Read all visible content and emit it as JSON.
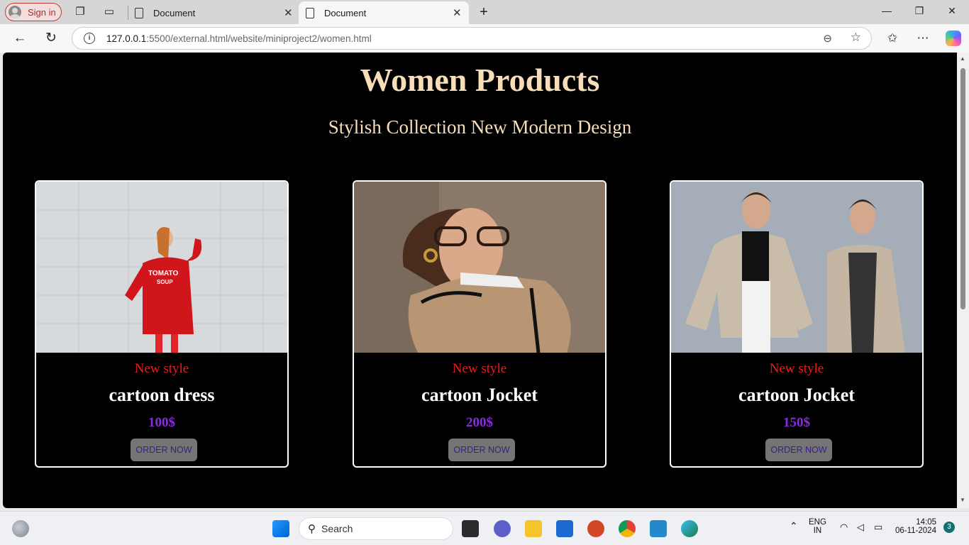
{
  "browser": {
    "signin_label": "Sign in",
    "tabs": [
      {
        "title": "Document"
      },
      {
        "title": "Document"
      }
    ],
    "url_host": "127.0.0.1",
    "url_path": ":5500/external.html/website/miniproject2/women.html"
  },
  "page": {
    "title": "Women Products",
    "subtitle": "Stylish Collection New Modern Design",
    "products": [
      {
        "tag": "New style",
        "name": "cartoon dress",
        "price": "100$",
        "button": "ORDER NOW",
        "shirt_text_1": "TOMATO",
        "shirt_text_2": "SOUP"
      },
      {
        "tag": "New style",
        "name": "cartoon Jocket",
        "price": "200$",
        "button": "ORDER NOW"
      },
      {
        "tag": "New style",
        "name": "cartoon Jocket",
        "price": "150$",
        "button": "ORDER NOW"
      }
    ]
  },
  "taskbar": {
    "search_label": "Search",
    "lang_1": "ENG",
    "lang_2": "IN",
    "time": "14:05",
    "date": "06-11-2024",
    "notification_count": "3"
  },
  "colors": {
    "title": "#f7ddb8",
    "tag": "#ee1c1c",
    "price": "#8a2be2",
    "button_bg": "#757575",
    "button_text": "#3b1e86"
  }
}
